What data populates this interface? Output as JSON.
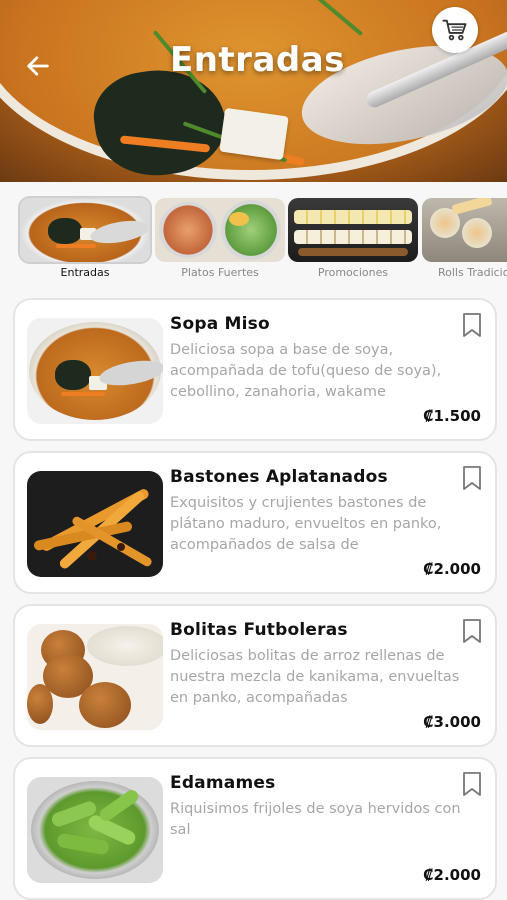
{
  "header": {
    "title": "Entradas",
    "back_icon": "arrow-left-icon",
    "cart_icon": "shopping-cart-icon"
  },
  "categories": [
    {
      "label": "Entradas",
      "active": true
    },
    {
      "label": "Platos Fuertes",
      "active": false
    },
    {
      "label": "Promociones",
      "active": false
    },
    {
      "label": "Rolls Tradicionales",
      "active": false
    }
  ],
  "products": [
    {
      "name": "Sopa Miso",
      "description": "Deliciosa sopa a base de soya, acompañada de tofu(queso de soya), cebollino, zanahoria, wakame",
      "price": "₡1.500"
    },
    {
      "name": "Bastones Aplatanados",
      "description": "Exquisitos y crujientes bastones de plátano maduro, envueltos en panko, acompañados de salsa de",
      "price": "₡2.000"
    },
    {
      "name": "Bolitas Futboleras",
      "description": "Deliciosas bolitas de arroz rellenas de nuestra mezcla de kanikama, envueltas en panko, acompañadas",
      "price": "₡3.000"
    },
    {
      "name": "Edamames",
      "description": "Riquisimos frijoles de soya hervidos con sal",
      "price": "₡2.000"
    }
  ],
  "colors": {
    "background": "#f7f7f7",
    "card_border": "#e4e4e4",
    "description": "#a6a6a6",
    "text": "#111111"
  }
}
